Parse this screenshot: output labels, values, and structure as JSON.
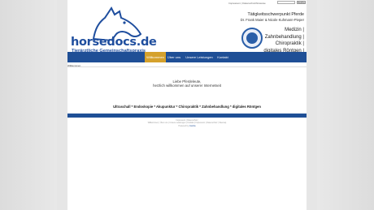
{
  "header": {
    "logo_text": "horsedocs.de",
    "logo_subtitle": "Tierärztliche Gemeinschaftspraxis",
    "top_links": "Impressum | Datenschutzhinweise",
    "search_button": "Suche",
    "focus_title": "Tätigkeitsschwerpunkt Pferde",
    "doctors": "Dr. Frank Maier & Nicole Kuhmann-Pieper",
    "services": [
      "Medizin |",
      "Zahnbehandlung |",
      "Chiropraktik |",
      "digitales Röntgen |"
    ]
  },
  "nav": {
    "items": [
      "Willkommen",
      "Über uns",
      "Unsere Leistungen",
      "Kontakt"
    ]
  },
  "content": {
    "breadcrumb": "Willkommen",
    "welcome_line1": "Liebe Pferdeleute,",
    "welcome_line2": "herzlich willkommen auf unserer Internetseit",
    "services_line": "Ultraschall * Endoskopie * Akupunktur * Chiropraktik * Zahnbehandlung * digitales Röntgen"
  },
  "footer": {
    "line1": "Impressum | Datenschutz",
    "line2": "Willkommen | Über uns | Unsere Leistungen | Kontakt | Impressum | Datenschutz | Sitemap",
    "line3_prefix": "Powered by",
    "line3_link": "Joomla"
  },
  "colors": {
    "brand_blue": "#1f4f96",
    "nav_active": "#d5a12c"
  }
}
